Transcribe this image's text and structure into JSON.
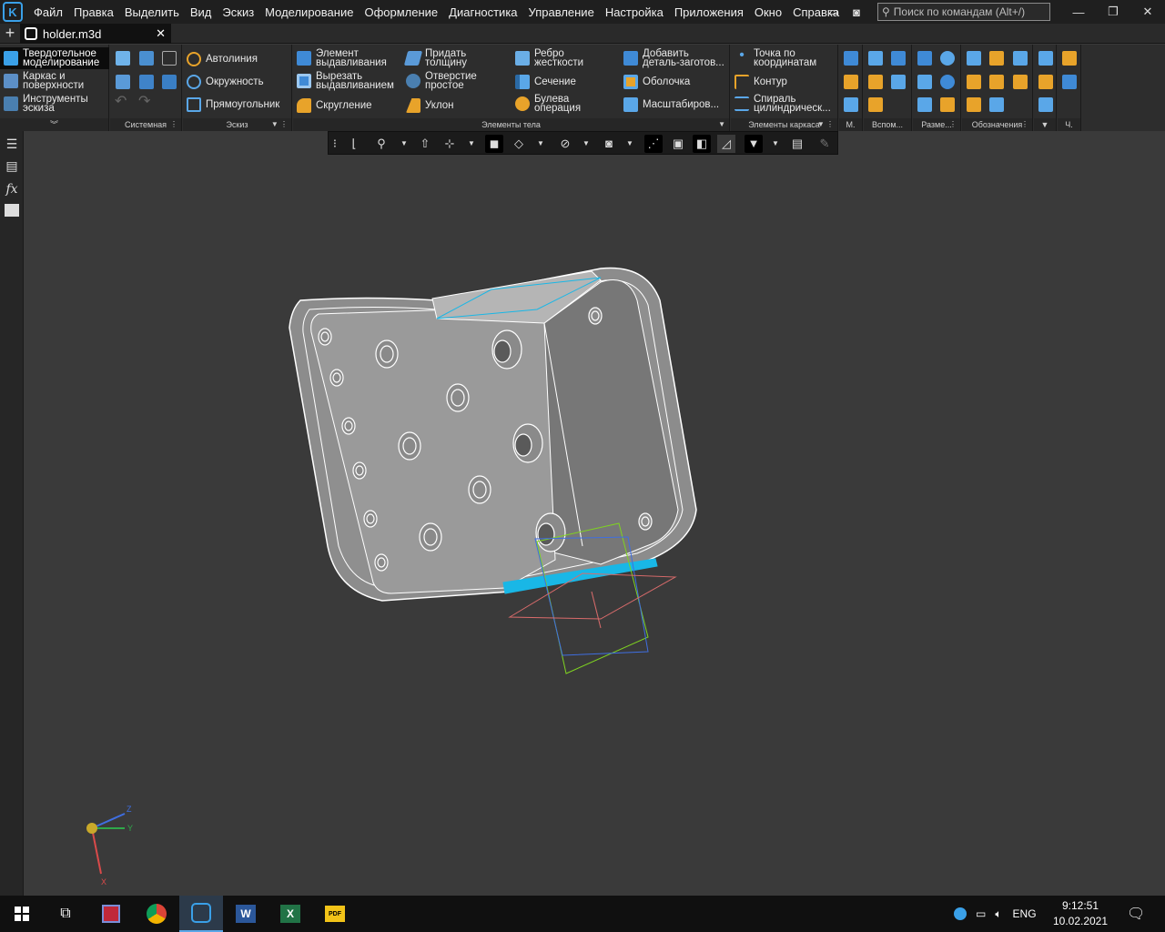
{
  "menu": {
    "items": [
      "Файл",
      "Правка",
      "Выделить",
      "Вид",
      "Эскиз",
      "Моделирование",
      "Оформление",
      "Диагностика",
      "Управление",
      "Настройка",
      "Приложения",
      "Окно",
      "Справка"
    ],
    "search_placeholder": "Поиск по командам (Alt+/)"
  },
  "tab": {
    "title": "holder.m3d",
    "close": "✕"
  },
  "ribbon": {
    "modes": [
      {
        "l1": "Твердотельное",
        "l2": "моделирование",
        "active": true
      },
      {
        "l1": "Каркас и",
        "l2": "поверхности",
        "active": false
      },
      {
        "l1": "Инструменты",
        "l2": "эскиза",
        "active": false
      }
    ],
    "sketch_items": [
      "Автолиния",
      "Окружность",
      "Прямоугольник"
    ],
    "body_items": [
      {
        "l1": "Элемент",
        "l2": "выдавливания"
      },
      {
        "l1": "Вырезать",
        "l2": "выдавливанием"
      },
      {
        "l1": "Скругление",
        "l2": ""
      },
      {
        "l1": "Придать",
        "l2": "толщину"
      },
      {
        "l1": "Отверстие",
        "l2": "простое"
      },
      {
        "l1": "Уклон",
        "l2": ""
      },
      {
        "l1": "Ребро",
        "l2": "жесткости"
      },
      {
        "l1": "Сечение",
        "l2": ""
      },
      {
        "l1": "Булева",
        "l2": "операция"
      },
      {
        "l1": "Добавить",
        "l2": "деталь-заготов..."
      },
      {
        "l1": "Оболочка",
        "l2": ""
      },
      {
        "l1": "Масштабиров...",
        "l2": ""
      }
    ],
    "frame_items": [
      {
        "l1": "Точка по",
        "l2": "координатам"
      },
      {
        "l1": "Контур",
        "l2": ""
      },
      {
        "l1": "Спираль",
        "l2": "цилиндрическ..."
      }
    ],
    "groups": [
      "Системная",
      "Эскиз",
      "Элементы тела",
      "Элементы каркаса",
      "М.",
      "Вспом...",
      "Разме...",
      "Обозначения",
      "Ч."
    ]
  },
  "axes": {
    "x": "X",
    "y": "Y",
    "z": "Z"
  },
  "taskbar": {
    "lang": "ENG",
    "time": "9:12:51",
    "date": "10.02.2021"
  },
  "colors": {
    "accent": "#3aa0e8",
    "selection": "#19b7e6",
    "plane_green": "#7fd321",
    "plane_blue": "#3f6ee0",
    "plane_red": "#d96b6b"
  }
}
